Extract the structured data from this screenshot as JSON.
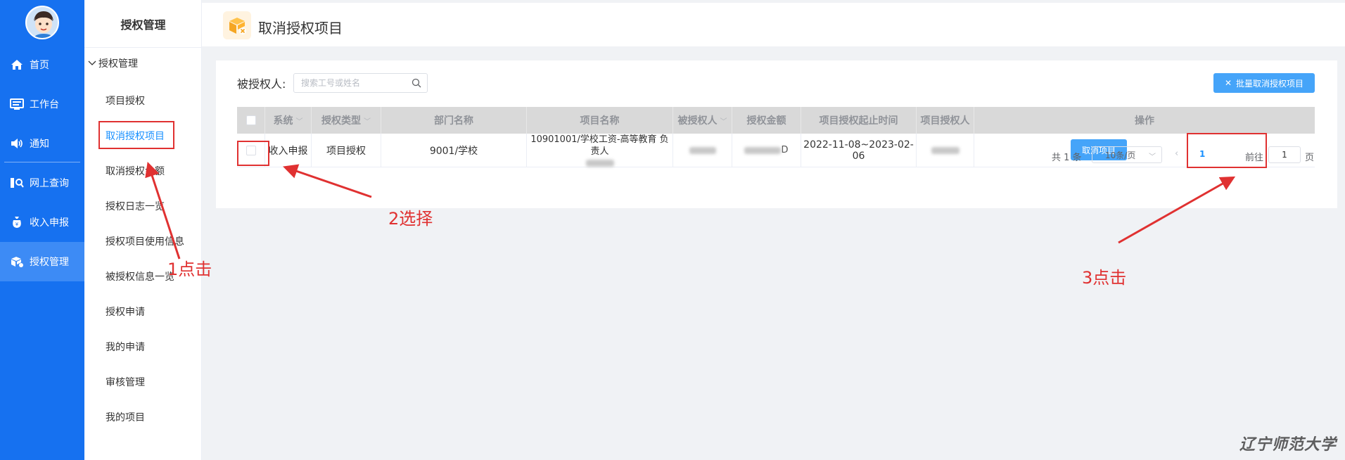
{
  "nav": {
    "items": [
      {
        "label": "首页",
        "icon": "home-icon"
      },
      {
        "label": "工作台",
        "icon": "desktop-icon"
      },
      {
        "label": "通知",
        "icon": "speaker-icon"
      },
      {
        "label": "网上查询",
        "icon": "query-icon"
      },
      {
        "label": "收入申报",
        "icon": "money-bag-icon"
      },
      {
        "label": "授权管理",
        "icon": "authorize-icon"
      }
    ],
    "active_index": 5
  },
  "subnav": {
    "title": "授权管理",
    "group": "授权管理",
    "items": [
      "项目授权",
      "取消授权项目",
      "取消授权金额",
      "授权日志一览",
      "授权项目使用信息",
      "被授权信息一览",
      "授权申请",
      "我的申请",
      "审核管理",
      "我的项目"
    ],
    "active_index": 1
  },
  "header": {
    "title": "取消授权项目"
  },
  "filter": {
    "label": "被授权人:",
    "placeholder": "搜索工号或姓名",
    "batch_button": "批量取消授权项目"
  },
  "table": {
    "headers": [
      "系统",
      "授权类型",
      "部门名称",
      "项目名称",
      "被授权人",
      "授权金额",
      "项目授权起止时间",
      "项目授权人",
      "操作"
    ],
    "rows": [
      {
        "system": "收入申报",
        "auth_type": "项目授权",
        "department": "9001/学校",
        "project_line1": "10901001/学校工资-高等教育 负责人",
        "amount_suffix": "D",
        "period": "2022-11-08~2023-02-06",
        "action": "取消项目"
      }
    ]
  },
  "pager": {
    "total": "共 1 条",
    "page_size": "10条/页",
    "current": "1",
    "goto": "前往",
    "jump_value": "1",
    "page_unit": "页"
  },
  "annotations": {
    "step1": "1点击",
    "step2": "2选择",
    "step3": "3点击",
    "color": "#e03131"
  },
  "watermark": "辽宁师范大学",
  "colors": {
    "nav_bg": "#1671f0",
    "nav_active": "#3d8bf5",
    "primary_button": "#45a4f9",
    "link_active": "#1890ff"
  }
}
